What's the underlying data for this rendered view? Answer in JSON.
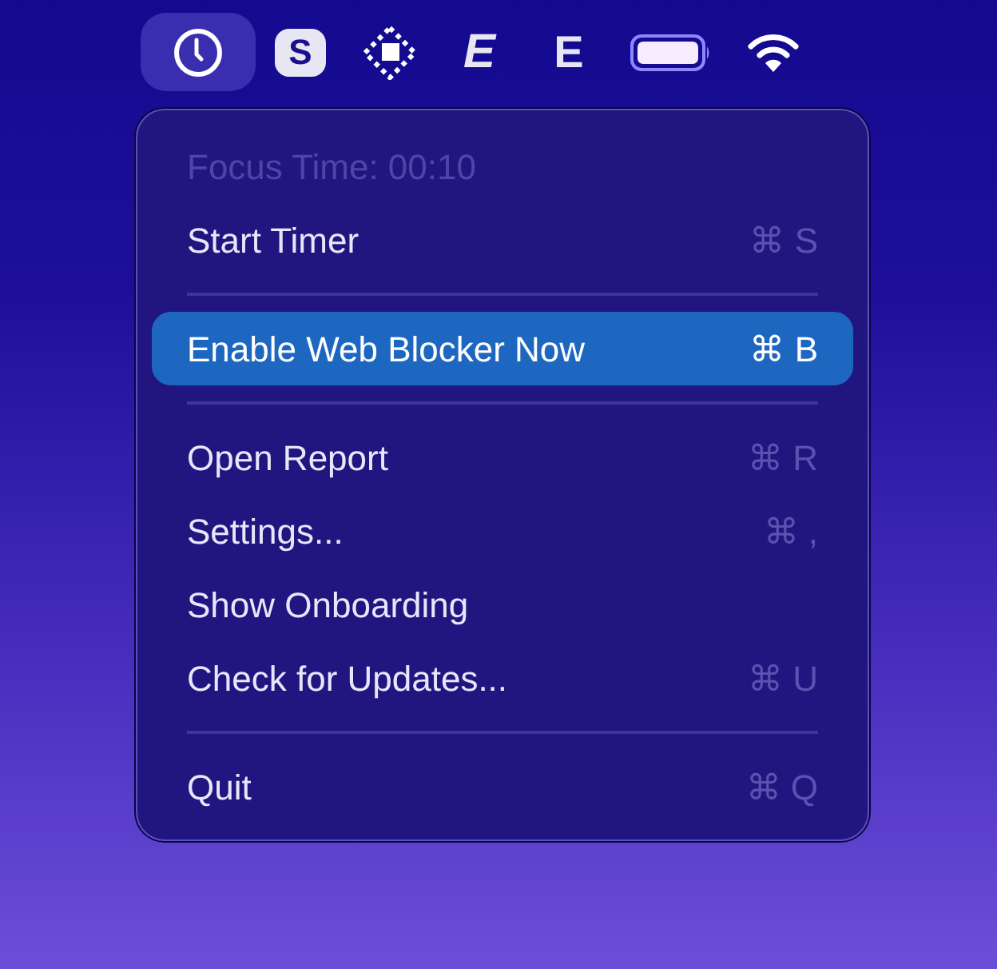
{
  "menu_bar": {
    "items": [
      {
        "kind": "clock",
        "selected": true
      },
      {
        "kind": "letter-badge",
        "text": "S",
        "selected": false
      },
      {
        "kind": "diamond",
        "selected": false
      },
      {
        "kind": "letter-stripes",
        "text": "E",
        "selected": false
      },
      {
        "kind": "letter",
        "text": "E",
        "selected": false
      },
      {
        "kind": "battery",
        "selected": false
      },
      {
        "kind": "wifi",
        "selected": false
      }
    ]
  },
  "menu": {
    "items": [
      {
        "kind": "item",
        "label": "Focus Time: 00:10",
        "disabled": true,
        "selected": false
      },
      {
        "kind": "item",
        "label": "Start Timer",
        "shortcut": "⌘ S",
        "disabled": false,
        "selected": false
      },
      {
        "kind": "separator"
      },
      {
        "kind": "item",
        "label": "Enable Web Blocker Now",
        "shortcut": "⌘ B",
        "disabled": false,
        "selected": true
      },
      {
        "kind": "separator"
      },
      {
        "kind": "item",
        "label": "Open Report",
        "shortcut": "⌘ R",
        "disabled": false,
        "selected": false
      },
      {
        "kind": "item",
        "label": "Settings...",
        "shortcut": "⌘ ,",
        "disabled": false,
        "selected": false
      },
      {
        "kind": "item",
        "label": "Show Onboarding",
        "disabled": false,
        "selected": false
      },
      {
        "kind": "item",
        "label": "Check for Updates...",
        "shortcut": "⌘ U",
        "disabled": false,
        "selected": false
      },
      {
        "kind": "separator"
      },
      {
        "kind": "item",
        "label": "Quit",
        "shortcut": "⌘ Q",
        "disabled": false,
        "selected": false
      }
    ]
  }
}
